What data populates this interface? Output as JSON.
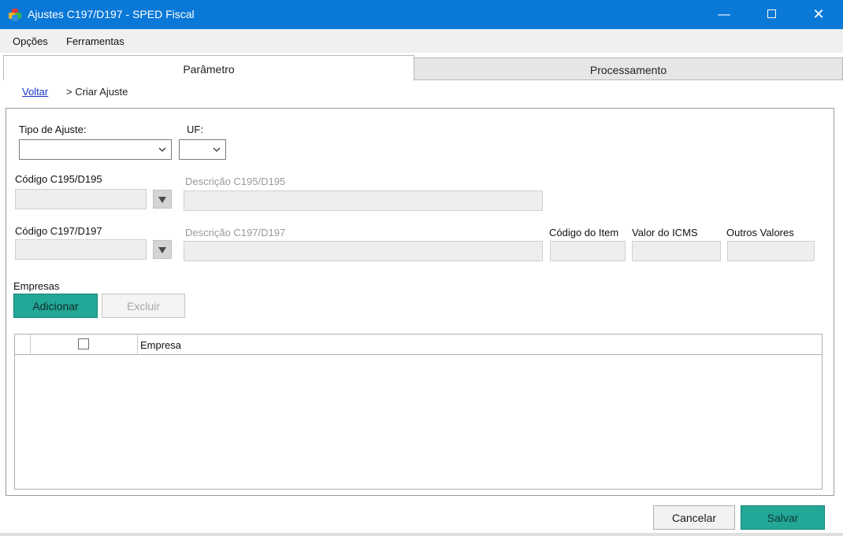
{
  "window": {
    "title": "Ajustes C197/D197 - SPED Fiscal",
    "minimize_glyph": "—",
    "close_glyph": "✕"
  },
  "menu": {
    "opcoes": "Opções",
    "ferramentas": "Ferramentas"
  },
  "tabs": [
    {
      "label": "Parâmetro",
      "active": true
    },
    {
      "label": "Processamento",
      "active": false
    }
  ],
  "breadcrumb": {
    "back_link": "Voltar",
    "current": "> Criar Ajuste"
  },
  "form": {
    "tipo_ajuste": {
      "label": "Tipo de Ajuste:",
      "value": ""
    },
    "uf": {
      "label": "UF:",
      "value": ""
    },
    "codigo_c195": {
      "label": "Código C195/D195",
      "value": ""
    },
    "descricao_c195": {
      "label": "Descrição C195/D195",
      "value": ""
    },
    "codigo_c197": {
      "label": "Código C197/D197",
      "value": ""
    },
    "descricao_c197": {
      "label": "Descrição C197/D197",
      "value": ""
    },
    "codigo_item": {
      "label": "Código do Item",
      "value": ""
    },
    "valor_icms": {
      "label": "Valor do ICMS",
      "value": ""
    },
    "outros_valores": {
      "label": "Outros Valores",
      "value": ""
    }
  },
  "empresas": {
    "label": "Empresas",
    "add_button": "Adicionar",
    "delete_button": "Excluir",
    "grid_header": "Empresa",
    "rows": []
  },
  "footer": {
    "cancel_button": "Cancelar",
    "save_button": "Salvar"
  },
  "colors": {
    "titlebar": "#0a78d7",
    "accent": "#23a797",
    "link": "#1a35c8"
  }
}
